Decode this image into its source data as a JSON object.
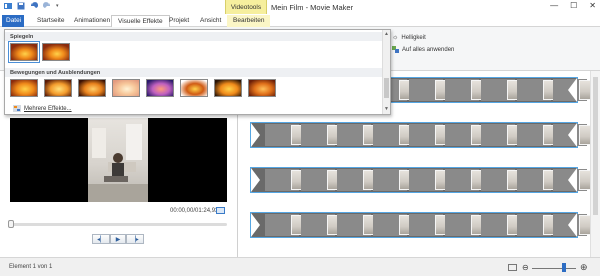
{
  "window": {
    "title": "Mein Film - Movie Maker",
    "contextual_group": "Videotools",
    "minimize": "—",
    "maximize": "☐",
    "close": "✕"
  },
  "tabs": [
    {
      "label": "Datei"
    },
    {
      "label": "Startseite"
    },
    {
      "label": "Animationen"
    },
    {
      "label": "Visuelle Effekte"
    },
    {
      "label": "Projekt"
    },
    {
      "label": "Ansicht"
    },
    {
      "label": "Bearbeiten"
    }
  ],
  "ribbon": {
    "brightness_label": "Helligkeit",
    "apply_all_label": "Auf alles anwenden"
  },
  "gallery": {
    "section_mirror": "Spiegeln",
    "section_motion": "Bewegungen und Ausblendungen",
    "more_effects": "Mehrere Effekte...",
    "mirror_effects": [
      "mirror-horizontal",
      "mirror-vertical"
    ],
    "motion_effects": [
      "fade-in-black",
      "fade-out-black",
      "fade-in-white",
      "fade-out-white",
      "edge-detection",
      "rotate-360",
      "pan-zoom",
      "cinematic"
    ]
  },
  "preview": {
    "timecode": "00:00,00/01:24,93"
  },
  "status": {
    "text": "Element 1 von 1"
  },
  "colors": {
    "file_tab": "#2b6cc4",
    "context_tab": "#f6ef9e",
    "track_border": "#55a6e3",
    "zoom_knob": "#2d6dc3"
  }
}
